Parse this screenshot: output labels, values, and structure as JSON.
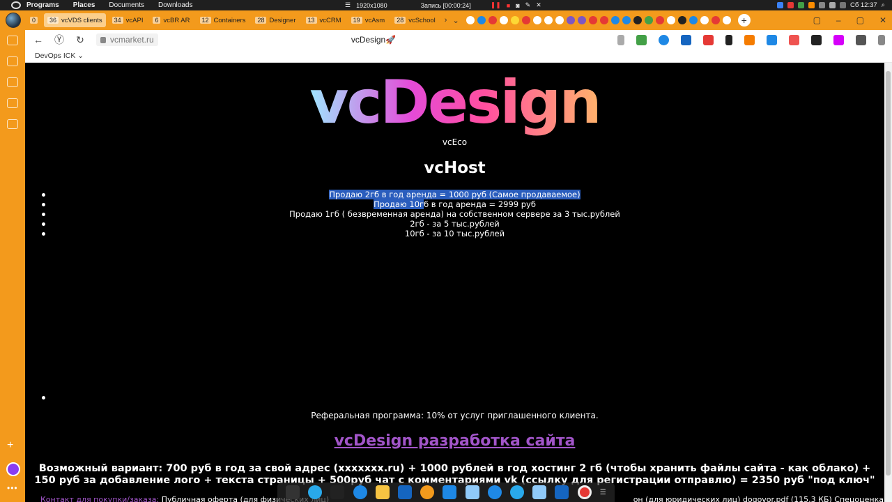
{
  "system_bar": {
    "menus": [
      "Programs",
      "Places",
      "Documents",
      "Downloads"
    ],
    "resolution": "1920x1080",
    "recording": "Запись [00:00:24]",
    "clock": "Сб 12:37"
  },
  "tabs": [
    {
      "count": "0",
      "label": ""
    },
    {
      "count": "36",
      "label": "vcVDS clients",
      "active": true
    },
    {
      "count": "34",
      "label": "vcAPI"
    },
    {
      "count": "6",
      "label": "vcBR AR"
    },
    {
      "count": "12",
      "label": "Containers"
    },
    {
      "count": "28",
      "label": "Designer"
    },
    {
      "count": "13",
      "label": "vcCRM"
    },
    {
      "count": "19",
      "label": "vcAsm"
    },
    {
      "count": "28",
      "label": "vcSchool"
    }
  ],
  "address_bar": {
    "url": "vcmarket.ru",
    "page_title": "vcDesign🚀"
  },
  "bookmarks": {
    "folder": "DevOps ICK"
  },
  "page": {
    "logo_text": "vcDesign",
    "vceco": "vcEco",
    "vchost_heading": "vcHost",
    "items": [
      {
        "pre": "",
        "sel": "Продаю 2гб в год аренда = 1000 руб (Самое продаваемое)",
        "post": ""
      },
      {
        "pre": "",
        "sel": "Продаю 10г",
        "post": "б в год аренда = 2999 руб"
      },
      {
        "pre": "Продаю 1гб ( безвременная аренда) на собственном сервере за 3 тыс.рублей",
        "sel": "",
        "post": ""
      },
      {
        "pre": "2гб - за 5 тыс.рублей",
        "sel": "",
        "post": ""
      },
      {
        "pre": "10гб - за 10 тыс.рублей",
        "sel": "",
        "post": ""
      }
    ],
    "referral": "Реферальная программа: 10% от услуг приглашенного клиента.",
    "design_link": "vcDesign разработка сайта",
    "offer": "Возможный вариант: 700 руб в год за свой адрес (xxxxxxx.ru) + 1000 рублей в год хостинг 2 гб (чтобы хранить файлы сайта - как облако) + 150 руб за добавление лого + текста страницы + 500руб чат с комментариями vk (ссылку для регистрации отправлю) = 2350 руб \"под ключ\"",
    "footer_contact": "Контакт для покупки/заказа:",
    "footer_offer": "Публичная оферта (для физических лиц)",
    "footer_right": "он (для юридических лиц) dogovor.pdf (115,3 КБ) Спецоценка"
  },
  "colors": {
    "browser_accent": "#f39a1c",
    "link_purple": "#a255c9",
    "selection": "#2a5dbd"
  }
}
